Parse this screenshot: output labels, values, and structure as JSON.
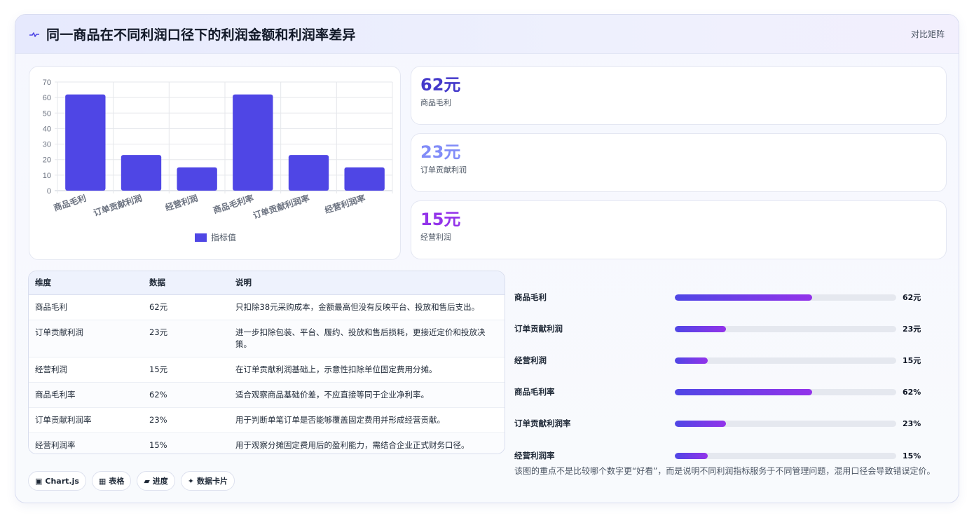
{
  "header": {
    "title": "同一商品在不同利润口径下的利润金额和利润率差异",
    "link_label": "对比矩阵"
  },
  "chart_data": {
    "type": "bar",
    "categories": [
      "商品毛利",
      "订单贡献利润",
      "经营利润",
      "商品毛利率",
      "订单贡献利润率",
      "经营利润率"
    ],
    "series": [
      {
        "name": "指标值",
        "values": [
          62,
          23,
          15,
          62,
          23,
          15
        ],
        "color": "#4f46e5"
      }
    ],
    "yticks": [
      "0",
      "10",
      "20",
      "30",
      "40",
      "50",
      "60",
      "70"
    ],
    "ylim": [
      0,
      70
    ],
    "grid": true,
    "legend_position": "bottom"
  },
  "stats": [
    {
      "value": "62元",
      "label": "商品毛利",
      "color": "#4338ca"
    },
    {
      "value": "23元",
      "label": "订单贡献利润",
      "color": "#818cf8"
    },
    {
      "value": "15元",
      "label": "经营利润",
      "color": "#9333ea"
    }
  ],
  "table": {
    "headers": [
      "维度",
      "数据",
      "说明"
    ],
    "rows": [
      [
        "商品毛利",
        "62元",
        "只扣除38元采购成本，金额最高但没有反映平台、投放和售后支出。"
      ],
      [
        "订单贡献利润",
        "23元",
        "进一步扣除包装、平台、履约、投放和售后损耗，更接近定价和投放决策。"
      ],
      [
        "经营利润",
        "15元",
        "在订单贡献利润基础上，示意性扣除单位固定费用分摊。"
      ],
      [
        "商品毛利率",
        "62%",
        "适合观察商品基础价差，不应直接等同于企业净利率。"
      ],
      [
        "订单贡献利润率",
        "23%",
        "用于判断单笔订单是否能够覆盖固定费用并形成经营贡献。"
      ],
      [
        "经营利润率",
        "15%",
        "用于观察分摊固定费用后的盈利能力，需结合企业正式财务口径。"
      ]
    ]
  },
  "progress": [
    {
      "label": "商品毛利",
      "value": "62元",
      "percent": 62
    },
    {
      "label": "订单贡献利润",
      "value": "23元",
      "percent": 23
    },
    {
      "label": "经营利润",
      "value": "15元",
      "percent": 15
    },
    {
      "label": "商品毛利率",
      "value": "62%",
      "percent": 62
    },
    {
      "label": "订单贡献利润率",
      "value": "23%",
      "percent": 23
    },
    {
      "label": "经营利润率",
      "value": "15%",
      "percent": 15
    }
  ],
  "note": "该图的重点不是比较哪个数字更“好看”，而是说明不同利润指标服务于不同管理问题，混用口径会导致错误定价。",
  "chips": [
    {
      "icon": "▣",
      "label": "Chart.js",
      "icon_name": "chart-icon"
    },
    {
      "icon": "▦",
      "label": "表格",
      "icon_name": "table-icon"
    },
    {
      "icon": "▰",
      "label": "进度",
      "icon_name": "progress-icon"
    },
    {
      "icon": "✦",
      "label": "数据卡片",
      "icon_name": "sparkle-icon"
    }
  ]
}
